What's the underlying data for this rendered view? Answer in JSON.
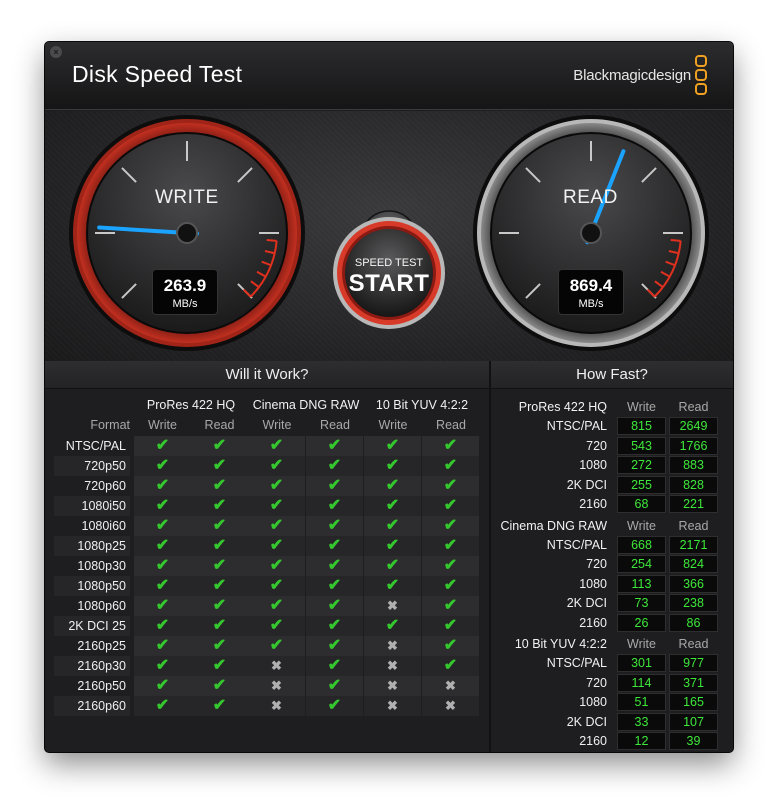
{
  "window": {
    "close_symbol": "×",
    "title": "Disk Speed Test",
    "brand": "Blackmagicdesign"
  },
  "gauges": {
    "write": {
      "label": "WRITE",
      "value": "263.9",
      "unit": "MB/s",
      "needle_fraction": 0.18,
      "color": "#1aa3ff"
    },
    "read": {
      "label": "READ",
      "value": "869.4",
      "unit": "MB/s",
      "needle_fraction": 0.58,
      "color": "#1aa3ff"
    }
  },
  "start_button": {
    "top_label": "SPEED TEST",
    "main_label": "START"
  },
  "settings_icon": "gear-icon",
  "will_it_work": {
    "title": "Will it Work?",
    "format_header": "Format",
    "groups": [
      "ProRes 422 HQ",
      "Cinema DNG RAW",
      "10 Bit YUV 4:2:2"
    ],
    "subcols": [
      "Write",
      "Read",
      "Write",
      "Read",
      "Write",
      "Read"
    ],
    "rows": [
      {
        "format": "NTSC/PAL",
        "checks": [
          1,
          1,
          1,
          1,
          1,
          1
        ]
      },
      {
        "format": "720p50",
        "checks": [
          1,
          1,
          1,
          1,
          1,
          1
        ]
      },
      {
        "format": "720p60",
        "checks": [
          1,
          1,
          1,
          1,
          1,
          1
        ]
      },
      {
        "format": "1080i50",
        "checks": [
          1,
          1,
          1,
          1,
          1,
          1
        ]
      },
      {
        "format": "1080i60",
        "checks": [
          1,
          1,
          1,
          1,
          1,
          1
        ]
      },
      {
        "format": "1080p25",
        "checks": [
          1,
          1,
          1,
          1,
          1,
          1
        ]
      },
      {
        "format": "1080p30",
        "checks": [
          1,
          1,
          1,
          1,
          1,
          1
        ]
      },
      {
        "format": "1080p50",
        "checks": [
          1,
          1,
          1,
          1,
          1,
          1
        ]
      },
      {
        "format": "1080p60",
        "checks": [
          1,
          1,
          1,
          1,
          0,
          1
        ]
      },
      {
        "format": "2K DCI 25",
        "checks": [
          1,
          1,
          1,
          1,
          1,
          1
        ]
      },
      {
        "format": "2160p25",
        "checks": [
          1,
          1,
          1,
          1,
          0,
          1
        ]
      },
      {
        "format": "2160p30",
        "checks": [
          1,
          1,
          0,
          1,
          0,
          1
        ]
      },
      {
        "format": "2160p50",
        "checks": [
          1,
          1,
          0,
          1,
          0,
          0
        ]
      },
      {
        "format": "2160p60",
        "checks": [
          1,
          1,
          0,
          1,
          0,
          0
        ]
      }
    ],
    "check_symbol": "✔",
    "cross_symbol": "✖"
  },
  "how_fast": {
    "title": "How Fast?",
    "write_header": "Write",
    "read_header": "Read",
    "groups": [
      {
        "name": "ProRes 422 HQ",
        "rows": [
          {
            "format": "NTSC/PAL",
            "write": "815",
            "read": "2649"
          },
          {
            "format": "720",
            "write": "543",
            "read": "1766"
          },
          {
            "format": "1080",
            "write": "272",
            "read": "883"
          },
          {
            "format": "2K DCI",
            "write": "255",
            "read": "828"
          },
          {
            "format": "2160",
            "write": "68",
            "read": "221"
          }
        ]
      },
      {
        "name": "Cinema DNG RAW",
        "rows": [
          {
            "format": "NTSC/PAL",
            "write": "668",
            "read": "2171"
          },
          {
            "format": "720",
            "write": "254",
            "read": "824"
          },
          {
            "format": "1080",
            "write": "113",
            "read": "366"
          },
          {
            "format": "2K DCI",
            "write": "73",
            "read": "238"
          },
          {
            "format": "2160",
            "write": "26",
            "read": "86"
          }
        ]
      },
      {
        "name": "10 Bit YUV 4:2:2",
        "rows": [
          {
            "format": "NTSC/PAL",
            "write": "301",
            "read": "977"
          },
          {
            "format": "720",
            "write": "114",
            "read": "371"
          },
          {
            "format": "1080",
            "write": "51",
            "read": "165"
          },
          {
            "format": "2K DCI",
            "write": "33",
            "read": "107"
          },
          {
            "format": "2160",
            "write": "12",
            "read": "39"
          }
        ]
      }
    ]
  }
}
